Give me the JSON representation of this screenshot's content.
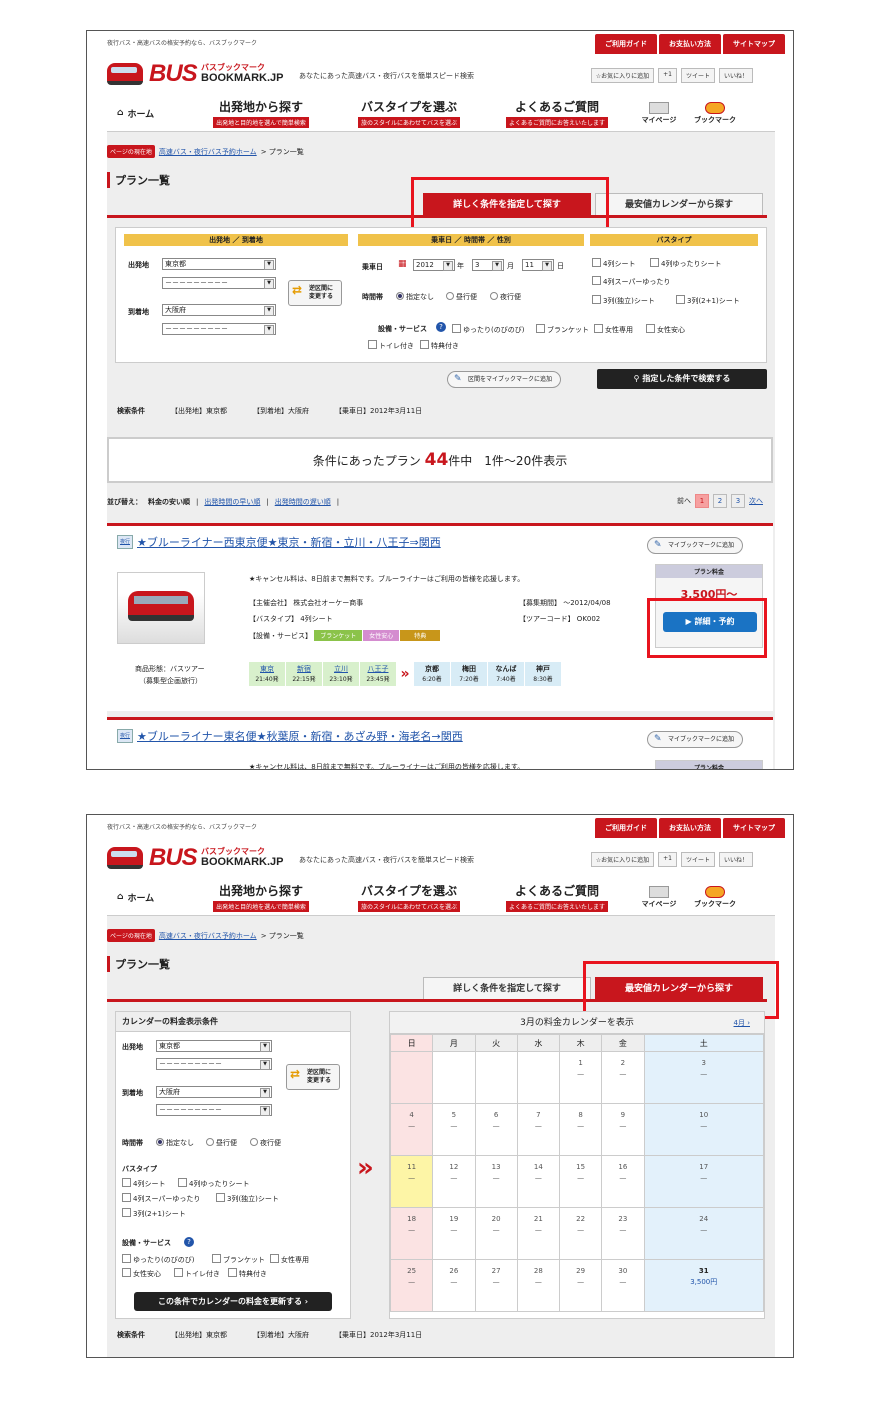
{
  "header": {
    "tagline": "夜行バス・高速バスの格安予約なら、バスブックマーク",
    "topnav": [
      "ご利用ガイド",
      "お支払い方法",
      "サイトマップ"
    ],
    "logo_bus": "BUS",
    "logo_sub": "バスブックマーク",
    "logo_bm": "BOOKMARK.JP",
    "desc": "あなたにあった高速バス・夜行バスを簡単スピード検索",
    "social": [
      "☆お気に入りに追加",
      "+1",
      "ツイート",
      "いいね！"
    ]
  },
  "gnav": {
    "home": "ホーム",
    "items": [
      {
        "title": "出発地から探す",
        "sub": "出発地と目的地を選んで簡単検索"
      },
      {
        "title": "バスタイプを選ぶ",
        "sub": "旅のスタイルにあわせてバスを選ぶ"
      },
      {
        "title": "よくあるご質問",
        "sub": "よくあるご質問にお答えいたします"
      }
    ],
    "mypage": "マイページ",
    "bookmark": "ブックマーク"
  },
  "crumb": {
    "label": "ページの現在地",
    "home": "高速バス・夜行バス予約ホーム",
    "current": "> プラン一覧"
  },
  "title": "プラン一覧",
  "tabs": {
    "detail": "詳しく条件を指定して探す",
    "calendar": "最安値カレンダーから探す"
  },
  "search": {
    "h_place": "出発地 ／ 到着地",
    "h_date": "乗車日 ／ 時間帯 ／ 性別",
    "h_type": "バスタイプ",
    "dep_label": "出発地",
    "arr_label": "到着地",
    "dep": "東京都",
    "arr": "大阪府",
    "blank": "－－－－－－－－－",
    "swap": "逆区間に 変更する",
    "date_label": "乗車日",
    "year": "2012",
    "year_u": "年",
    "month": "3",
    "month_u": "月",
    "day": "11",
    "day_u": "日",
    "time_label": "時間帯",
    "time_opts": [
      "指定なし",
      "昼行便",
      "夜行便"
    ],
    "types": [
      "4列シート",
      "4列ゆったりシート",
      "4列スーパーゆったり",
      "3列(独立)シート",
      "3列(2+1)シート"
    ],
    "svc_label": "設備・サービス",
    "svc": [
      "ゆったり(のびのび)",
      "ブランケット",
      "女性専用",
      "女性安心",
      "トイレ付き",
      "特典付き"
    ],
    "add_btn": "区間をマイブックマークに追加",
    "search_btn": "指定した条件で検索する"
  },
  "conditions": {
    "label": "検索条件",
    "dep": "【出発地】東京都",
    "arr": "【到着地】大阪府",
    "date": "【乗車日】2012年3月11日"
  },
  "result": {
    "pre": "条件にあったプラン",
    "count": "44",
    "post": "件中　1件〜20件表示"
  },
  "sort": {
    "label": "並び替え：",
    "opts": [
      "料金の安い順",
      "出発時間の早い順",
      "出発時間の遅い順"
    ],
    "prev": "前へ",
    "pages": [
      "1",
      "2",
      "3"
    ],
    "next": "次へ"
  },
  "plans": [
    {
      "badge": "夜行",
      "title": "★ブルーライナー西東京便★東京・新宿・立川・八王子⇒関西",
      "bookmark": "マイブックマークに追加",
      "notice": "★キャンセル料は、8日前まで無料です。ブルーライナーはご利用の皆様を応援します。",
      "org": "【主催会社】 株式会社オーケー商事",
      "period": "【募集期間】 〜2012/04/08",
      "bustype": "【バスタイプ】 4列シート",
      "code": "【ツアーコード】 OK002",
      "svc": "【設備・サービス】",
      "tags": [
        "ブランケット",
        "女性安心",
        "特典"
      ],
      "form": "商品形態：バスツアー",
      "form2": "（募集型企画旅行）",
      "price_h": "プラン料金",
      "price": "3,500円〜",
      "detail": "詳細・予約",
      "dep": [
        {
          "n": "東京",
          "t": "21:40発"
        },
        {
          "n": "新宿",
          "t": "22:15発"
        },
        {
          "n": "立川",
          "t": "23:10発"
        },
        {
          "n": "八王子",
          "t": "23:45発"
        }
      ],
      "arr": [
        {
          "n": "京都",
          "t": "6:20着"
        },
        {
          "n": "梅田",
          "t": "7:20着"
        },
        {
          "n": "なんば",
          "t": "7:40着"
        },
        {
          "n": "神戸",
          "t": "8:30着"
        }
      ]
    },
    {
      "badge": "夜行",
      "title": "★ブルーライナー東名便★秋葉原・新宿・あざみ野・海老名→関西",
      "bookmark": "マイブックマークに追加",
      "notice": "★キャンセル料は、8日前まで無料です。ブルーライナーはご利用の皆様を応援します。",
      "price_h": "プラン料金"
    }
  ],
  "calendar": {
    "cond_title": "カレンダーの料金表示条件",
    "time_label": "時間帯",
    "type_label": "バスタイプ",
    "svc_label": "設備・サービス",
    "update_btn": "この条件でカレンダーの料金を更新する ›",
    "title": "3月の料金カレンダーを表示",
    "next": "4月 ›",
    "weekdays": [
      "日",
      "月",
      "火",
      "水",
      "木",
      "金",
      "土"
    ],
    "dash": "—",
    "last_price": "3,500円",
    "weeks": [
      [
        "",
        "",
        "",
        "",
        "1",
        "2",
        "3"
      ],
      [
        "4",
        "5",
        "6",
        "7",
        "8",
        "9",
        "10"
      ],
      [
        "11",
        "12",
        "13",
        "14",
        "15",
        "16",
        "17"
      ],
      [
        "18",
        "19",
        "20",
        "21",
        "22",
        "23",
        "24"
      ],
      [
        "25",
        "26",
        "27",
        "28",
        "29",
        "30",
        "31"
      ]
    ]
  }
}
